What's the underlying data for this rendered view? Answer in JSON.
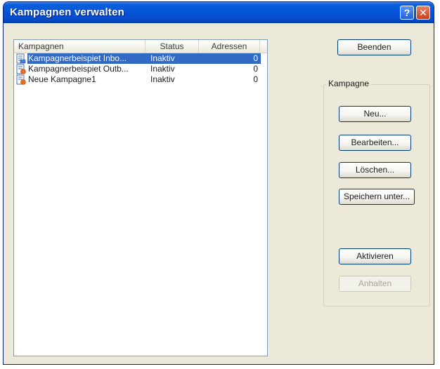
{
  "window": {
    "title": "Kampagnen verwalten",
    "help_glyph": "?",
    "close_glyph": "✕"
  },
  "list": {
    "columns": [
      "Kampagnen",
      "Status",
      "Adressen"
    ],
    "rows": [
      {
        "name": "Kampagnerbeispiet Inbo...",
        "status": "Inaktiv",
        "addresses": "0",
        "selected": true
      },
      {
        "name": "Kampagnerbeispiet Outb...",
        "status": "Inaktiv",
        "addresses": "0",
        "selected": false
      },
      {
        "name": "Neue Kampagne1",
        "status": "Inaktiv",
        "addresses": "0",
        "selected": false
      }
    ]
  },
  "buttons": {
    "close": "Beenden",
    "new": "Neu...",
    "edit": "Bearbeiten...",
    "delete": "Löschen...",
    "save_as": "Speichern unter...",
    "activate": "Aktivieren",
    "pause": "Anhalten"
  },
  "group": {
    "label": "Kampagne"
  },
  "colors": {
    "selection": "#316ac5",
    "titlebar": "#0553d8"
  }
}
